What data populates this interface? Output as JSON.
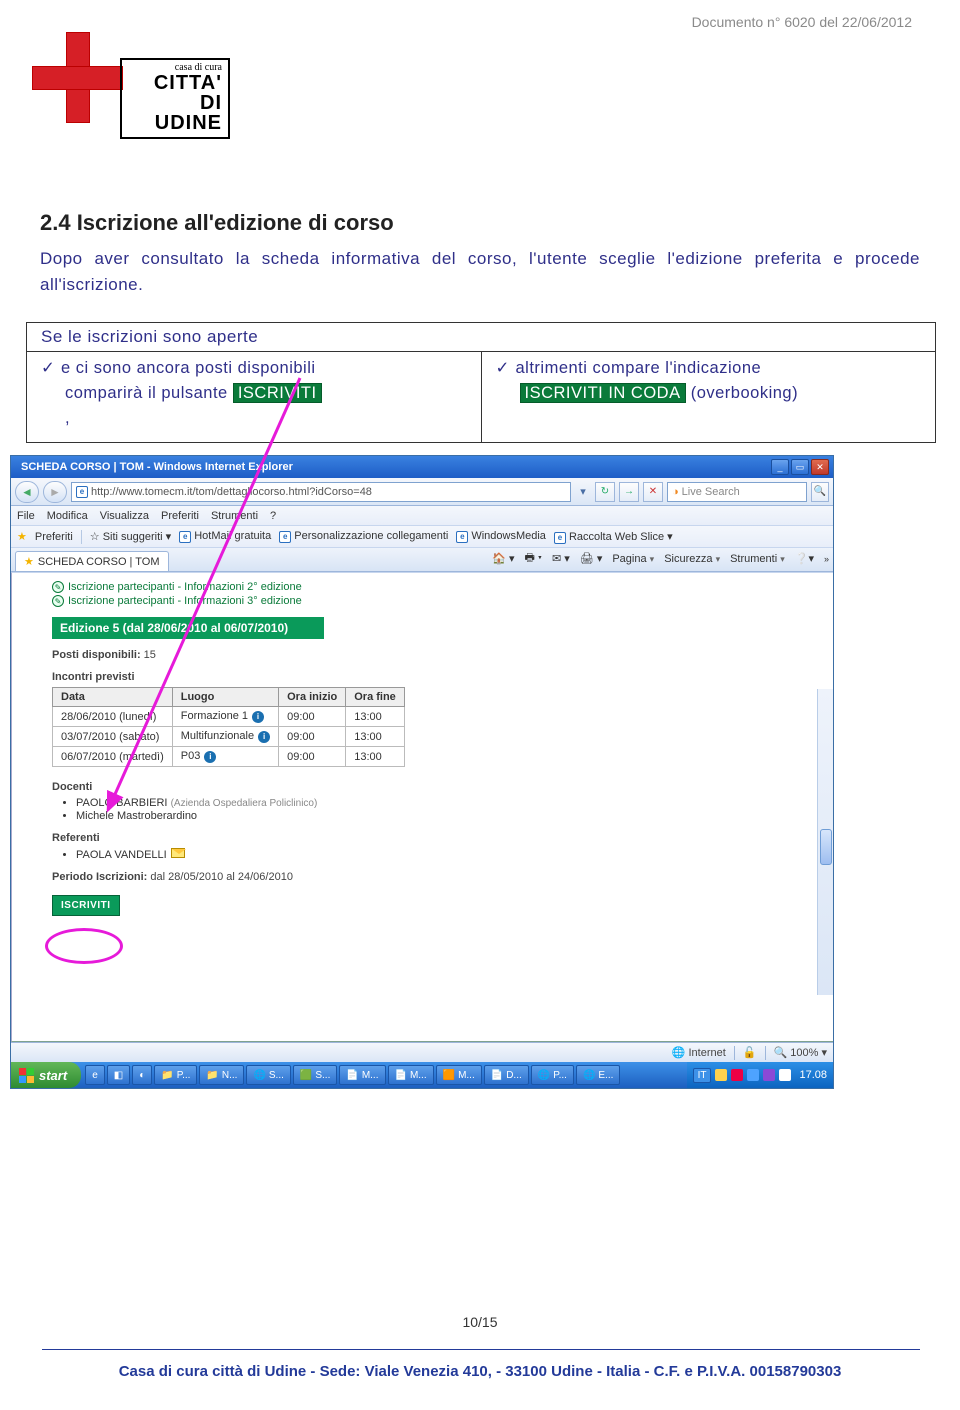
{
  "header": {
    "doc_ref": "Documento n° 6020 del 22/06/2012",
    "logo_line1": "casa di cura",
    "logo_line2": "CITTA'",
    "logo_line3": "DI UDINE"
  },
  "section": {
    "number_title": "2.4 Iscrizione all'edizione di corso",
    "para": "Dopo aver consultato la scheda informativa del corso, l'utente sceglie l'edizione preferita e procede all'iscrizione."
  },
  "box": {
    "top": "Se le iscrizioni sono aperte",
    "left_line1": "e ci sono ancora posti disponibili",
    "left_line2a": "comparirà il pulsante ",
    "left_badge": "ISCRIVITI",
    "left_line3": ",",
    "right_line1": "altrimenti compare l'indicazione",
    "right_badge": "ISCRIVITI IN CODA",
    "right_tail": "(overbooking)"
  },
  "browser": {
    "title": "SCHEDA CORSO | TOM - Windows Internet Explorer",
    "url": "http://www.tomecm.it/tom/dettagliocorso.html?idCorso=48",
    "search_placeholder": "Live Search",
    "menu": [
      "File",
      "Modifica",
      "Visualizza",
      "Preferiti",
      "Strumenti",
      "?"
    ],
    "fav_label": "Preferiti",
    "fav_suggested": "Siti suggeriti",
    "fav_links": [
      "HotMail gratuita",
      "Personalizzazione collegamenti",
      "WindowsMedia",
      "Raccolta Web Slice"
    ],
    "tab_label": "SCHEDA CORSO | TOM",
    "tools": {
      "pagina": "Pagina",
      "sicurezza": "Sicurezza",
      "strumenti": "Strumenti"
    }
  },
  "page": {
    "links": [
      "Iscrizione partecipanti - Informazioni 2° edizione",
      "Iscrizione partecipanti - Informazioni 3° edizione"
    ],
    "edition_title": "Edizione 5 (dal 28/06/2010 al 06/07/2010)",
    "posti_label": "Posti disponibili:",
    "posti_value": "15",
    "incontri_label": "Incontri previsti",
    "table": {
      "headers": [
        "Data",
        "Luogo",
        "Ora inizio",
        "Ora fine"
      ],
      "rows": [
        {
          "data": "28/06/2010 (lunedì)",
          "luogo": "Formazione 1",
          "inizio": "09:00",
          "fine": "13:00"
        },
        {
          "data": "03/07/2010 (sabato)",
          "luogo": "Multifunzionale",
          "inizio": "09:00",
          "fine": "13:00"
        },
        {
          "data": "06/07/2010 (martedì)",
          "luogo": "P03",
          "inizio": "09:00",
          "fine": "13:00"
        }
      ]
    },
    "docenti_label": "Docenti",
    "docenti": [
      {
        "name": "PAOLO BARBIERI",
        "note": "(Azienda Ospedaliera Policlinico)"
      },
      {
        "name": "Michele Mastroberardino",
        "note": ""
      }
    ],
    "referenti_label": "Referenti",
    "referenti": [
      "PAOLA VANDELLI"
    ],
    "periodo_label": "Periodo Iscrizioni:",
    "periodo_value": "dal 28/05/2010 al 24/06/2010",
    "iscriviti_btn": "ISCRIVITI"
  },
  "status": {
    "internet": "Internet",
    "zoom": "100%"
  },
  "taskbar": {
    "start": "start",
    "tasks": [
      "P...",
      "N...",
      "S...",
      "S...",
      "M...",
      "M...",
      "M...",
      "D...",
      "P...",
      "E..."
    ],
    "lang": "IT",
    "clock": "17.08"
  },
  "footer": {
    "page": "10/15",
    "text": "Casa di cura città di Udine - Sede: Viale Venezia 410, - 33100 Udine - Italia - C.F. e P.I.V.A. 00158790303"
  }
}
